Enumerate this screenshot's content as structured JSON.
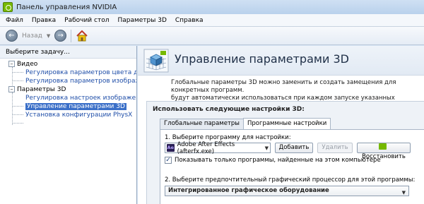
{
  "window": {
    "title": "Панель управления NVIDIA"
  },
  "menu": [
    "Файл",
    "Правка",
    "Рабочий стол",
    "Параметры 3D",
    "Справка"
  ],
  "toolbar": {
    "back_label": "Назад"
  },
  "left_panel": {
    "header": "Выберите задачу...",
    "tree": {
      "video": {
        "label": "Видео",
        "items": [
          "Регулировка параметров цвета для вид",
          "Регулировка параметров изображения д"
        ]
      },
      "params3d": {
        "label": "Параметры 3D",
        "items": [
          "Регулировка настроек изображения с пр",
          "Управление параметрами 3D",
          "Установка конфигурации PhysX"
        ]
      }
    }
  },
  "main": {
    "title": "Управление параметрами 3D",
    "description_line1": "Глобальные параметры 3D можно заменить и создать замещения для конкретных программ.",
    "description_line2": "будут автоматически использоваться при каждом запуске указанных программ.",
    "settings_label": "Использовать следующие настройки 3D:",
    "tabs": [
      "Глобальные параметры",
      "Программные настройки"
    ],
    "step1_label": "1. Выберите программу для настройки:",
    "program_value": "Adobe After Effects (afterfx.exe)",
    "add_button": "Добавить",
    "remove_button": "Удалить",
    "restore_button": "Восстановить",
    "checkbox_label": "Показывать только программы, найденные на этом компьютере",
    "step2_label": "2. Выберите предпочтительный графический процессор для этой программы:",
    "gpu_value": "Интегрированное графическое оборудование"
  },
  "colors": {
    "accent": "#76b900",
    "selection": "#3a6fc8",
    "link": "#1f4ea8"
  }
}
